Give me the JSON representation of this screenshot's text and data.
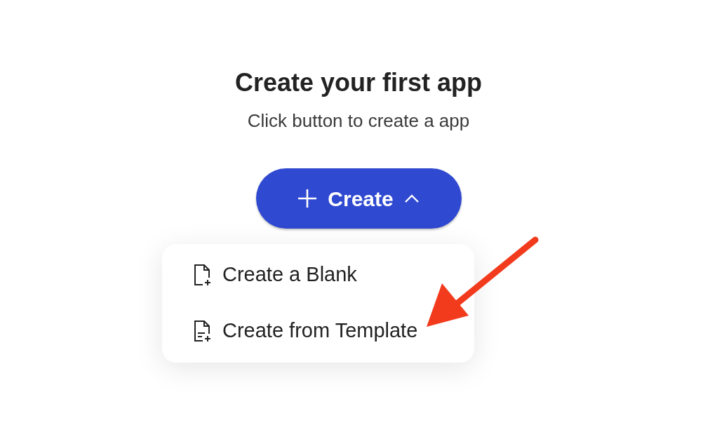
{
  "heading": "Create your first app",
  "subheading": "Click button to create a app",
  "create_button": {
    "label": "Create",
    "expanded": true
  },
  "menu": [
    {
      "kind": "blank",
      "label": "Create a Blank"
    },
    {
      "kind": "template",
      "label": "Create from Template"
    }
  ]
}
